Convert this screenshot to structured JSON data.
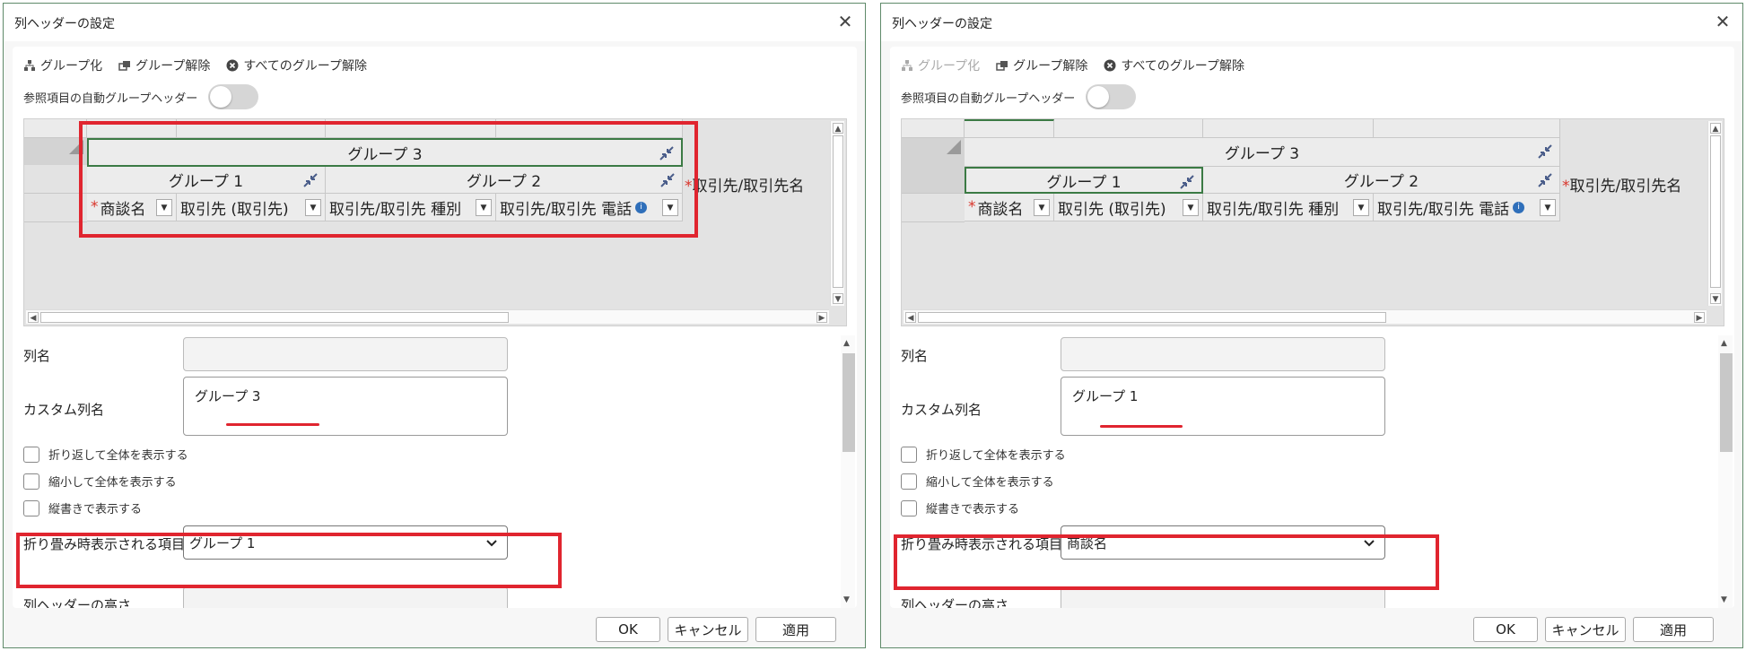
{
  "dialogs": [
    {
      "title": "列ヘッダーの設定",
      "toolbar": {
        "group": "グループ化",
        "ungroup": "グループ解除",
        "ungroup_all": "すべてのグループ解除"
      },
      "auto_group_label": "参照項目の自動グループヘッダー",
      "grid": {
        "group3": "グループ 3",
        "group1": "グループ 1",
        "group2": "グループ 2",
        "leaf1": "商談名",
        "leaf2": "取引先 (取引先)",
        "leaf3": "取引先/取引先 種別",
        "leaf4": "取引先/取引先 電話",
        "side": "取引先/取引先名",
        "required_mark": "*",
        "info_mark": "i"
      },
      "props": {
        "col_name_label": "列名",
        "custom_name_label": "カスタム列名",
        "custom_name_value": "グループ 3",
        "wrap_label": "折り返して全体を表示する",
        "shrink_label": "縮小して全体を表示する",
        "vertical_label": "縦書きで表示する",
        "collapsed_item_label": "折り畳み時表示される項目",
        "collapsed_item_value": "グループ 1",
        "height_label": "列ヘッダーの高さ"
      },
      "buttons": {
        "ok": "OK",
        "cancel": "キャンセル",
        "apply": "適用"
      }
    },
    {
      "title": "列ヘッダーの設定",
      "toolbar": {
        "group": "グループ化",
        "ungroup": "グループ解除",
        "ungroup_all": "すべてのグループ解除"
      },
      "auto_group_label": "参照項目の自動グループヘッダー",
      "grid": {
        "group3": "グループ 3",
        "group1": "グループ 1",
        "group2": "グループ 2",
        "leaf1": "商談名",
        "leaf2": "取引先 (取引先)",
        "leaf3": "取引先/取引先 種別",
        "leaf4": "取引先/取引先 電話",
        "side": "取引先/取引先名",
        "required_mark": "*",
        "info_mark": "i"
      },
      "props": {
        "col_name_label": "列名",
        "custom_name_label": "カスタム列名",
        "custom_name_value": "グループ 1",
        "wrap_label": "折り返して全体を表示する",
        "shrink_label": "縮小して全体を表示する",
        "vertical_label": "縦書きで表示する",
        "collapsed_item_label": "折り畳み時表示される項目",
        "collapsed_item_value": "商談名",
        "height_label": "列ヘッダーの高さ"
      },
      "buttons": {
        "ok": "OK",
        "cancel": "キャンセル",
        "apply": "適用"
      }
    }
  ],
  "colors": {
    "highlight_red": "#e0252f",
    "selection_green": "#3b7a44",
    "required_red": "#d9352b",
    "info_blue": "#2f6fba"
  },
  "icons": [
    "group-icon",
    "ungroup-icon",
    "ungroup-all-icon",
    "close-icon",
    "collapse-icon",
    "chevron-down-icon",
    "info-icon",
    "dropdown-icon"
  ]
}
